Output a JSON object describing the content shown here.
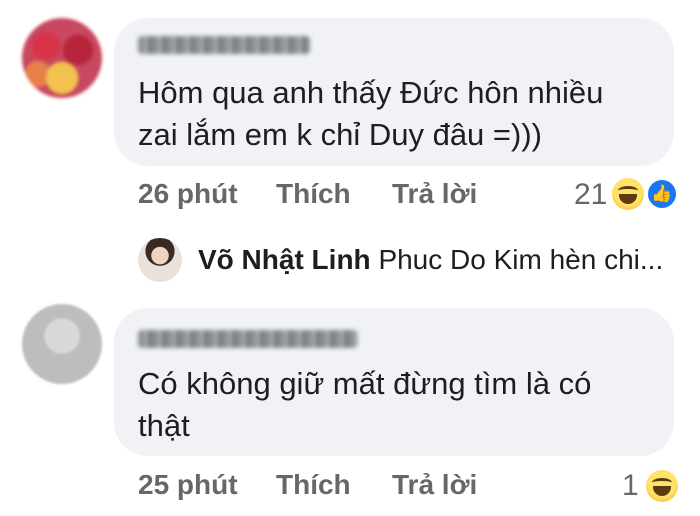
{
  "comments": [
    {
      "time": "26 phút",
      "like_label": "Thích",
      "reply_label": "Trả lời",
      "text": "Hôm qua anh thấy Đức hôn nhiều\nzai lắm em k chỉ Duy đâu =)))",
      "reaction_count": "21",
      "reactions": [
        "haha-icon",
        "like-icon"
      ]
    },
    {
      "time": "25 phút",
      "like_label": "Thích",
      "reply_label": "Trả lời",
      "text": "Có không giữ mất đừng tìm là có\nthật",
      "reaction_count": "1",
      "reactions": [
        "haha-icon"
      ]
    }
  ],
  "reply": {
    "name": "Võ Nhật Linh",
    "text": "Phuc Do Kim  hèn chi..."
  },
  "colors": {
    "bubble": "#f0f2f5",
    "meta": "#65676b",
    "text": "#1c1e21",
    "like": "#1877f2"
  }
}
